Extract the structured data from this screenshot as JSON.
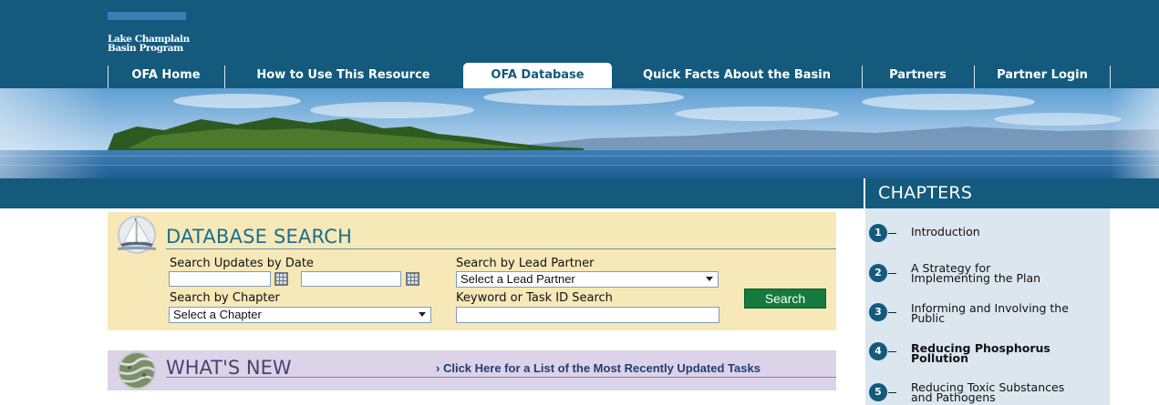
{
  "logo": {
    "line1": "Lake Champlain",
    "line2": "Basin Program"
  },
  "nav": {
    "items": [
      {
        "label": "OFA Home",
        "active": false
      },
      {
        "label": "How to Use This Resource",
        "active": false
      },
      {
        "label": "OFA Database",
        "active": true
      },
      {
        "label": "Quick Facts About the Basin",
        "active": false
      },
      {
        "label": "Partners",
        "active": false
      },
      {
        "label": "Partner Login",
        "active": false
      }
    ]
  },
  "database_search": {
    "title": "DATABASE SEARCH",
    "date_label": "Search Updates by Date",
    "date_from_value": "",
    "date_to_value": "",
    "lead_partner_label": "Search by Lead Partner",
    "lead_partner_selected": "Select a Lead Partner",
    "chapter_label": "Search by Chapter",
    "chapter_selected": "Select a Chapter",
    "keyword_label": "Keyword or Task ID Search",
    "keyword_value": "",
    "search_button": "Search"
  },
  "whats_new": {
    "title": "WHAT'S NEW",
    "link_arrow": "›",
    "link": "Click Here for a List of the Most Recently Updated Tasks"
  },
  "chapters": {
    "heading": "CHAPTERS",
    "items": [
      {
        "number": "1",
        "line1": "Introduction",
        "line2": "",
        "bold": false
      },
      {
        "number": "2",
        "line1": "A Strategy for",
        "line2": "Implementing the Plan",
        "bold": false
      },
      {
        "number": "3",
        "line1": "Informing and Involving the",
        "line2": "Public",
        "bold": false
      },
      {
        "number": "4",
        "line1": "Reducing Phosphorus",
        "line2": "Pollution",
        "bold": true
      },
      {
        "number": "5",
        "line1": "Reducing Toxic Substances",
        "line2": "and Pathogens",
        "bold": false
      }
    ]
  },
  "colors": {
    "header_blue": "#135a7d",
    "search_panel": "#f7e8b8",
    "whats_new_panel": "#ddd3e8",
    "chapters_panel": "#dce6ef",
    "search_button": "#157a3e"
  },
  "icons": [
    "sailboat-icon",
    "wetland-aerial-icon",
    "calendar-icon",
    "chevron-down-icon",
    "chevron-right-icon"
  ]
}
